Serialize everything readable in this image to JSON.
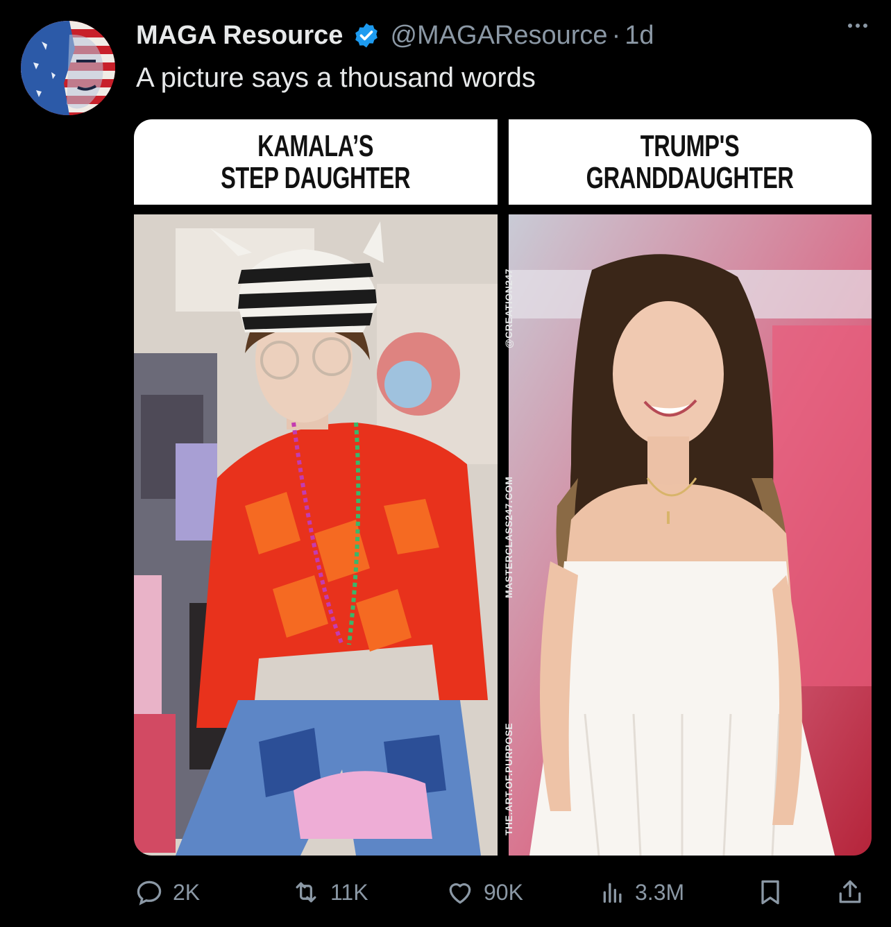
{
  "post": {
    "author_name": "MAGA Resource",
    "author_handle": "@MAGAResource",
    "separator": "·",
    "timestamp": "1d",
    "text": "A picture says a thousand words"
  },
  "media": {
    "left_label_line1": "KAMALA’S",
    "left_label_line2": "STEP DAUGHTER",
    "right_label_line1": "TRUMP'S",
    "right_label_line2": "GRANDDAUGHTER",
    "watermark_top": "@CREATION247",
    "watermark_middle": "MASTERCLASS247.COM",
    "watermark_bottom": "THE.ART.OF.PURPOSE"
  },
  "stats": {
    "replies": "2K",
    "reposts": "11K",
    "likes": "90K",
    "views": "3.3M"
  },
  "colors": {
    "background": "#000000",
    "text_primary": "#e7e9ea",
    "text_secondary": "#8b98a5",
    "verified_badge": "#1d9bf0"
  },
  "icons": [
    "reply-icon",
    "repost-icon",
    "like-icon",
    "views-icon",
    "bookmark-icon",
    "share-icon",
    "verified-icon",
    "more-icon"
  ]
}
